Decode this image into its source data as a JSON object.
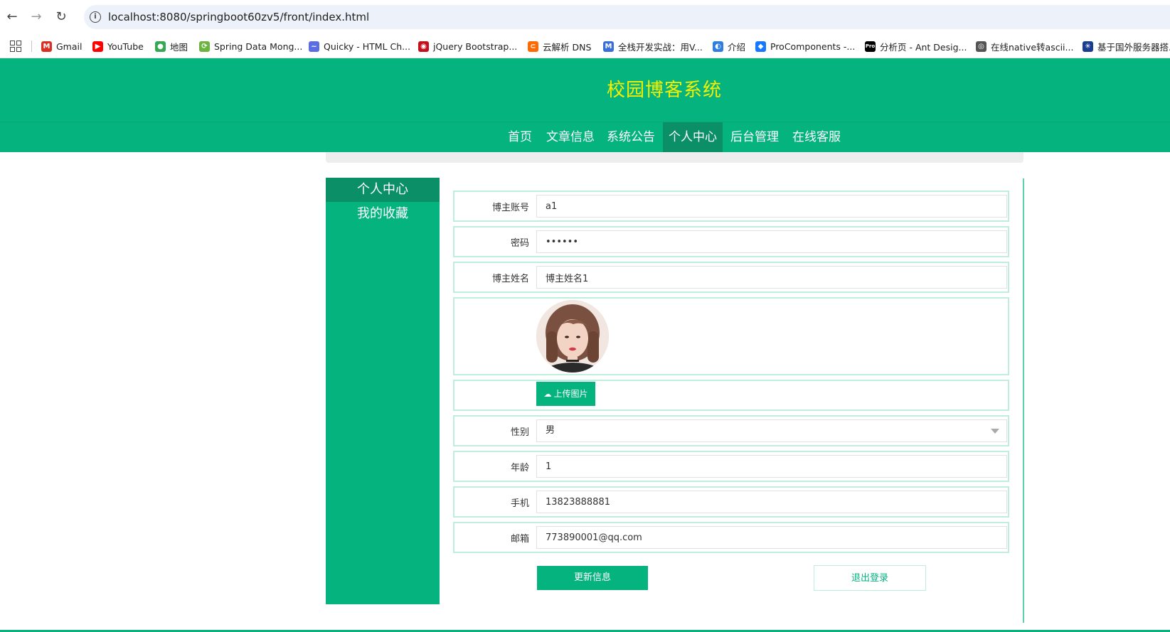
{
  "browser": {
    "url": "localhost:8080/springboot60zv5/front/index.html",
    "bookmarks": [
      {
        "label": "Gmail",
        "icon": "gmail-icon",
        "color": "#d93025",
        "glyph": "M"
      },
      {
        "label": "YouTube",
        "icon": "youtube-icon",
        "color": "#ff0000",
        "glyph": "▶"
      },
      {
        "label": "地图",
        "icon": "maps-icon",
        "color": "#34a853",
        "glyph": "●"
      },
      {
        "label": "Spring Data Mong...",
        "icon": "spring-icon",
        "color": "#6db33f",
        "glyph": "⟳"
      },
      {
        "label": "Quicky - HTML Ch...",
        "icon": "messenger-icon",
        "color": "#5b6ee1",
        "glyph": "~"
      },
      {
        "label": "jQuery Bootstrap...",
        "icon": "jquery-icon",
        "color": "#c2111b",
        "glyph": "◉"
      },
      {
        "label": "云解析 DNS",
        "icon": "aliyun-icon",
        "color": "#ff6a00",
        "glyph": "⊂"
      },
      {
        "label": "全栈开发实战：用V...",
        "icon": "m-icon",
        "color": "#3b6fd8",
        "glyph": "M"
      },
      {
        "label": "介绍",
        "icon": "globe-icon",
        "color": "#2f7ee0",
        "glyph": "◐"
      },
      {
        "label": "ProComponents -...",
        "icon": "antd-icon",
        "color": "#1677ff",
        "glyph": "◆"
      },
      {
        "label": "分析页 - Ant Desig...",
        "icon": "pro-icon",
        "color": "#000000",
        "glyph": "Pro"
      },
      {
        "label": "在线native转ascii...",
        "icon": "chrome-icon",
        "color": "#555555",
        "glyph": "◎"
      },
      {
        "label": "基于国外服务器搭...",
        "icon": "sync-icon",
        "color": "#1a3d8f",
        "glyph": "✳"
      }
    ]
  },
  "site": {
    "title": "校园博客系统",
    "nav": [
      {
        "label": "首页"
      },
      {
        "label": "文章信息"
      },
      {
        "label": "系统公告"
      },
      {
        "label": "个人中心",
        "active": true
      },
      {
        "label": "后台管理"
      },
      {
        "label": "在线客服"
      }
    ]
  },
  "sidebar": {
    "items": [
      {
        "label": "个人中心",
        "active": true
      },
      {
        "label": "我的收藏"
      }
    ]
  },
  "form": {
    "account_label": "博主账号",
    "account_value": "a1",
    "password_label": "密码",
    "password_value": "123456",
    "name_label": "博主姓名",
    "name_value": "博主姓名1",
    "upload_label": "上传图片",
    "gender_label": "性别",
    "gender_value": "男",
    "age_label": "年龄",
    "age_value": "1",
    "phone_label": "手机",
    "phone_value": "13823888881",
    "email_label": "邮箱",
    "email_value": "773890001@qq.com",
    "update_button": "更新信息",
    "logout_button": "退出登录"
  },
  "colors": {
    "brand": "#05b37f",
    "brand_dark": "#0a8f66",
    "title_yellow": "#f4f000"
  }
}
